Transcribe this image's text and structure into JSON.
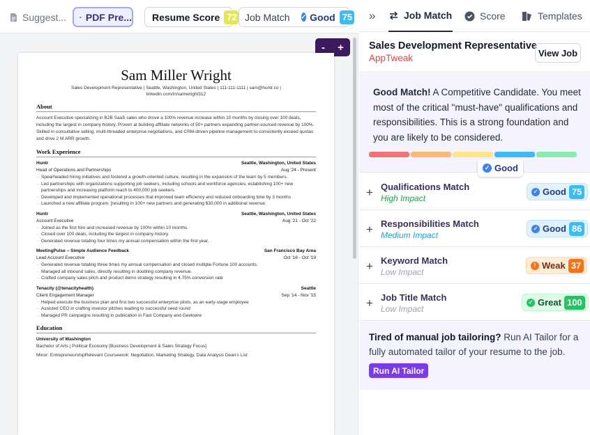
{
  "toolbar": {
    "suggestions": "Suggest...",
    "pdf_preview": "PDF Pre...",
    "resume_score_label": "Resume Score",
    "resume_score_value": "72",
    "job_match_label": "Job Match",
    "job_match_rating": "Good",
    "job_match_value": "75",
    "zoom_out": "-",
    "zoom_in": "+"
  },
  "resume": {
    "name": "Sam Miller Wright",
    "contact_line1": "Sales Development Representative  |  Seattle, Washington, United States  |  111-111-1111  |  sam@huntr.co  |",
    "contact_line2": "linkedin.com/in/samwright312",
    "about_heading": "About",
    "about_text": "Account Executive specializing in B2B SaaS sales who drove a 100% revenue increase within 10 months by closing over 100 deals, including the largest in company history. Proven at building affiliate networks of 50+ partners expanding partner-sourced revenue by 100%. Skilled in consultative selling, multi-threaded enterprise negotiations, and CRM-driven pipeline management to consistently exceed quotas and drive 2 M ARR growth.",
    "experience_heading": "Work Experience",
    "jobs": [
      {
        "company": "Huntr",
        "location": "Seattle, Washington, United States",
        "title": "Head of Operations and Partnerships",
        "dates": "Aug '24 - Present",
        "bullets": [
          "Spearheaded hiring initiatives and fostered a growth-oriented culture, resulting in the expansion of the team by 5 members.",
          "Led partnerships with organizations supporting job seekers, including schools and workforce agencies, establishing 100+ new partnerships and increasing platform reach to 400,000 job seekers.",
          "Developed and implemented operational processes that improved team efficiency and reduced onboarding time by 3 months",
          "Launched a new affiliate program, [resulting in 100+ new partners and generating $30,000 in additional revenue."
        ]
      },
      {
        "company": "Huntr",
        "location": "Seattle, Washington, United States",
        "title": "Account Executive",
        "dates": "Aug '21 - Oct '22",
        "bullets": [
          "Joined as the first hire and increased revenue by 100% within 10 months.",
          "Closed over 100 deals, including the largest in company history.",
          "Generated revenue totaling four times my annual compensation within the first year."
        ]
      },
      {
        "company": "MeetingPulse – Simple Audience Feedback",
        "location": "San Francisco Bay Area",
        "title": "Lead Account Executive",
        "dates": "Oct '18 - Oct '19",
        "bullets": [
          "Generated revenue totaling three times my annual compensation and closed multiple Fortune 100 accounts.",
          "Managed all inbound sales, directly resulting in doubling company revenue.",
          "Crafted company sales pitch and product demo strategy resulting in 4.75% conversion rate"
        ]
      },
      {
        "company": "Tenacity (@tenacityhealth)",
        "location": "Seattle",
        "title": "Client Engagement Manager",
        "dates": "Sep '14 - Nov '15",
        "bullets": [
          "Helped execute the business plan and first two successful enterprise pilots, as an early-stage employee",
          "Assisted CEO in crafting investor pitches leading to successful seed round",
          "Managed PR campaigns resulting in publication in Fast Company and Geekwire"
        ]
      }
    ],
    "education_heading": "Education",
    "school": "University of Washington",
    "degree": "Bachelor of Arts | Political Economy [Business Development & Sales Strategy Focus]",
    "minor": "Minor: EntrepreneurshipRelevant Coursework: Negotiation, Marketing Strategy, Data Analysis  Dean's List"
  },
  "panel": {
    "tab_collapse": "»",
    "tab_job_match": "Job Match",
    "tab_score": "Score",
    "tab_templates": "Templates",
    "job_title": "Sales Development Representative",
    "company": "AppTweak",
    "view_job": "View Job",
    "summary_bold": "Good Match!",
    "summary_text": " A Competitive Candidate. You meet most of the critical \"must-have\" qualifications and responsibilities. This is a strong foundation and you are likely to be considered.",
    "overall_rating": "Good",
    "scale_colors": [
      "#f87171",
      "#fdba74",
      "#fde68a",
      "#38bdf8",
      "#86efac"
    ],
    "active_segment": 4,
    "metrics": [
      {
        "title": "Qualifications Match",
        "impact": "High Impact",
        "impact_color": "#16a34a",
        "rating": "Good",
        "score": "75",
        "kind": "good"
      },
      {
        "title": "Responsibilities Match",
        "impact": "Medium Impact",
        "impact_color": "#0ea5e9",
        "rating": "Good",
        "score": "86",
        "kind": "good"
      },
      {
        "title": "Keyword Match",
        "impact": "Low Impact",
        "impact_color": "#9ca3af",
        "rating": "Weak",
        "score": "37",
        "kind": "weak"
      },
      {
        "title": "Job Title Match",
        "impact": "Low Impact",
        "impact_color": "#9ca3af",
        "rating": "Great",
        "score": "100",
        "kind": "great"
      }
    ],
    "tailor_bold": "Tired of manual job tailoring?",
    "tailor_text": " Run AI Tailor for a fully automated tailor of your resume to the job.",
    "tailor_button": "Run AI Tailor"
  }
}
